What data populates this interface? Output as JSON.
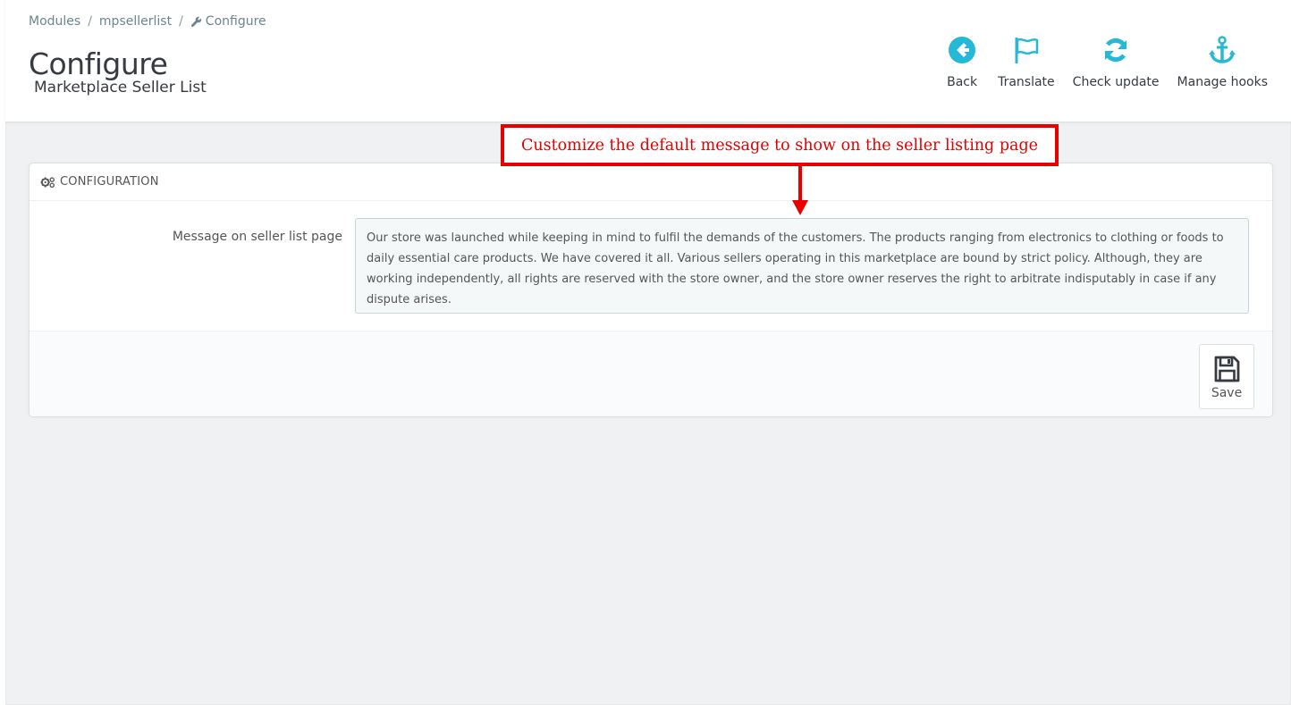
{
  "breadcrumb": {
    "items": [
      "Modules",
      "mpsellerlist"
    ],
    "current": "Configure",
    "separator": "/"
  },
  "header": {
    "title": "Configure",
    "subtitle": "Marketplace Seller List"
  },
  "toolbar": {
    "items": [
      {
        "label": "Back",
        "icon": "arrow-circle-left-icon"
      },
      {
        "label": "Translate",
        "icon": "flag-icon"
      },
      {
        "label": "Check update",
        "icon": "refresh-icon"
      },
      {
        "label": "Manage hooks",
        "icon": "anchor-icon"
      }
    ],
    "icon_color": "#25b9d7"
  },
  "annotation": {
    "text": "Customize the default message to show on the seller listing page",
    "color": "#e80000"
  },
  "panel": {
    "heading": "CONFIGURATION",
    "heading_icon": "cogs-icon",
    "field_label": "Message on seller list page",
    "field_value": "Our store was launched while keeping in mind to fulfil the demands of the customers. The products ranging from electronics to clothing or foods to daily essential care products. We have covered it all. Various sellers operating in this marketplace are bound by strict policy. Although, they are working independently, all rights are reserved with the store owner, and the store owner reserves the right to arbitrate indisputably in case if any dispute arises.",
    "save_label": "Save",
    "save_icon": "floppy-disk-icon"
  }
}
